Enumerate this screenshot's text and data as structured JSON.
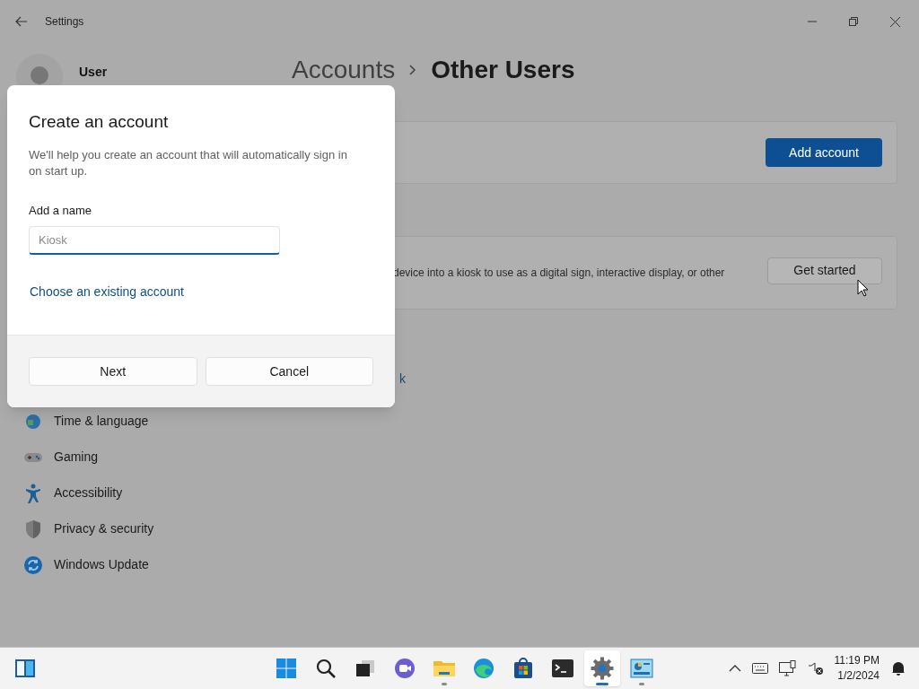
{
  "window": {
    "title": "Settings"
  },
  "user": {
    "name": "User"
  },
  "breadcrumb": {
    "parent": "Accounts",
    "current": "Other Users"
  },
  "cards": [
    {
      "kind": "add",
      "button": "Add account"
    },
    {
      "kind": "kiosk",
      "description": "device into a kiosk to use as a digital sign, interactive display, or other",
      "button": "Get started"
    }
  ],
  "link_fragment": "k",
  "sidebar": {
    "items": [
      {
        "kind": "time",
        "label": "Time & language"
      },
      {
        "kind": "gaming",
        "label": "Gaming"
      },
      {
        "kind": "accessibility",
        "label": "Accessibility"
      },
      {
        "kind": "privacy",
        "label": "Privacy & security"
      },
      {
        "kind": "update",
        "label": "Windows Update"
      }
    ]
  },
  "dialog": {
    "title": "Create an account",
    "description": "We'll help you create an account that will automatically sign in on start up.",
    "field_label": "Add a name",
    "field": {
      "placeholder": "Kiosk"
    },
    "link": "Choose an existing account",
    "buttons": [
      "Next",
      "Cancel"
    ]
  },
  "taskbar": {
    "apps": [
      {
        "kind": "start",
        "running": false,
        "active": false
      },
      {
        "kind": "search",
        "running": false,
        "active": false
      },
      {
        "kind": "taskview",
        "running": false,
        "active": false
      },
      {
        "kind": "chat",
        "running": false,
        "active": false
      },
      {
        "kind": "explorer",
        "running": true,
        "active": false
      },
      {
        "kind": "edge",
        "running": false,
        "active": false
      },
      {
        "kind": "store",
        "running": false,
        "active": false
      },
      {
        "kind": "terminal",
        "running": false,
        "active": false
      },
      {
        "kind": "settings",
        "running": true,
        "active": true
      },
      {
        "kind": "dashboard",
        "running": true,
        "active": false
      }
    ],
    "clock": {
      "time": "11:19 PM",
      "date": "1/2/2024"
    }
  }
}
